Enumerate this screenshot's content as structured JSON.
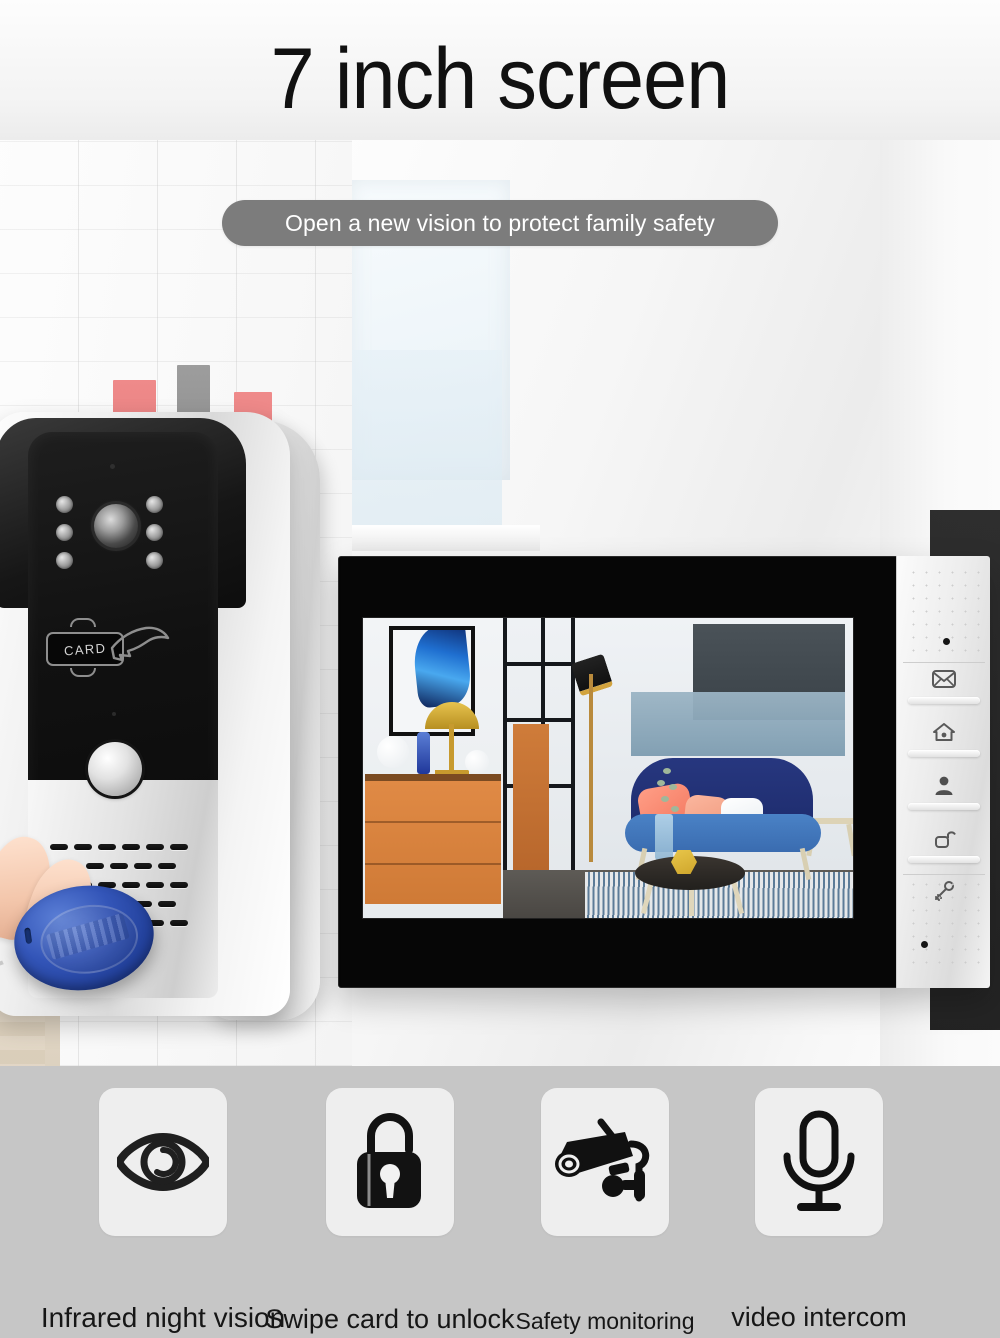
{
  "hero": {
    "title": "7 inch screen",
    "subtitle": "Open a new vision to protect family safety",
    "subtitle_pill_color": "#7c7c7c",
    "title_color": "#111111",
    "background_color": "#fbfbfb"
  },
  "doorbell": {
    "name": "outdoor-door-station",
    "card_reader_label": "CARD",
    "lens_name": "camera-lens",
    "ir_led_count": 6,
    "call_button_name": "doorbell-call-button",
    "speaker_name": "speaker-grille",
    "keyfob_name": "rfid-key-fob",
    "keyfob_color": "#22409a"
  },
  "monitor": {
    "name": "indoor-monitor",
    "screen_content": "living-room-camera-view",
    "bezel_color": "#060606",
    "panel_color": "#ededed",
    "buttons": [
      {
        "icon": "envelope-icon",
        "name": "message-button"
      },
      {
        "icon": "house-icon",
        "name": "home-button"
      },
      {
        "icon": "person-icon",
        "name": "visitor-button"
      },
      {
        "icon": "unlock-icon",
        "name": "unlock-button"
      },
      {
        "icon": "key-icon",
        "name": "key-button"
      }
    ]
  },
  "features": {
    "band_color": "#c6c6c6",
    "tile_color": "#eeeeee",
    "items": [
      {
        "icon": "eye-icon",
        "label": "Infrared night vision"
      },
      {
        "icon": "open-padlock-icon",
        "label": "Swipe card to unlock"
      },
      {
        "icon": "cctv-camera-icon",
        "label": "Safety monitoring"
      },
      {
        "icon": "microphone-icon",
        "label": "video intercom"
      }
    ]
  }
}
